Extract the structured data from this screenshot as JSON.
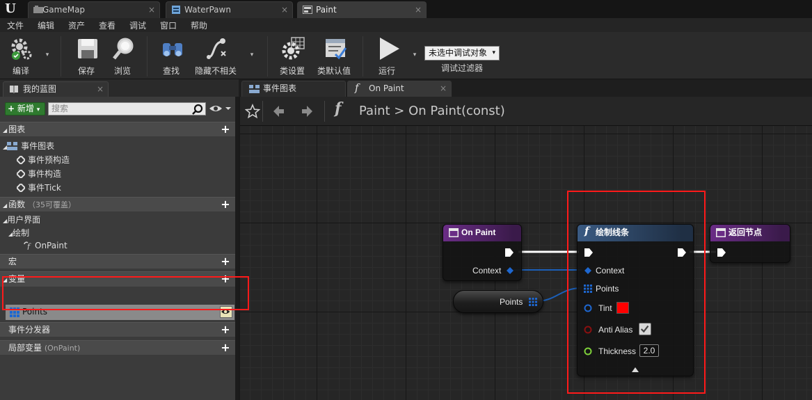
{
  "app": {
    "logo": "U",
    "tabs": [
      {
        "label": "GameMap",
        "icon": "level-map-icon",
        "active": false
      },
      {
        "label": "WaterPawn",
        "icon": "blueprint-icon",
        "active": false
      },
      {
        "label": "Paint",
        "icon": "widget-blueprint-icon",
        "active": true
      }
    ],
    "close_glyph": "×"
  },
  "menu": [
    "文件",
    "编辑",
    "资产",
    "查看",
    "调试",
    "窗口",
    "帮助"
  ],
  "toolbar": {
    "compile": "编译",
    "save": "保存",
    "browse": "浏览",
    "find": "查找",
    "hide_unrelated": "隐藏不相关",
    "class_settings": "类设置",
    "class_defaults": "类默认值",
    "run": "运行",
    "debug_selector": "未选中调试对象",
    "debug_filter": "调试过滤器",
    "caret": "▾"
  },
  "my_blueprint": {
    "tab_label": "我的蓝图",
    "new_button": "新增",
    "search_placeholder": "搜索",
    "sections": {
      "graphs": "图表",
      "functions": "函数",
      "functions_sub": "（35可覆盖）",
      "ui": "用户界面",
      "macros": "宏",
      "variables": "变量",
      "event_dispatchers": "事件分发器",
      "local_vars": "局部变量",
      "local_vars_sub": "(OnPaint)"
    },
    "graph_items": {
      "event_graph": "事件图表",
      "events": [
        "事件预构造",
        "事件构造",
        "事件Tick"
      ]
    },
    "ui_items": {
      "draw": "绘制",
      "on_paint": "OnPaint"
    },
    "variables": [
      {
        "name": "Points",
        "type": "array"
      }
    ]
  },
  "graph_editor": {
    "tabs": [
      {
        "label": "事件图表",
        "icon": "event-graph-icon",
        "active": false
      },
      {
        "label": "On Paint",
        "icon": "function-icon",
        "active": true
      }
    ],
    "breadcrumb": [
      "Paint",
      "On Paint(const)"
    ],
    "breadcrumb_sep": ">",
    "func_glyph": "f"
  },
  "nodes": {
    "on_paint": {
      "title": "On Paint",
      "pin_context": "Context",
      "color": "#6a2d86"
    },
    "draw_lines": {
      "title": "绘制线条",
      "pins": {
        "context": "Context",
        "points": "Points",
        "tint": "Tint",
        "anti_alias": "Anti Alias",
        "thickness": "Thickness"
      },
      "tint_color": "#ff0000",
      "anti_alias_checked": true,
      "thickness_value": "2.0",
      "color": "#3a5a82"
    },
    "return_node": {
      "title": "返回节点",
      "color": "#6a2d86"
    },
    "points_var": {
      "label": "Points"
    }
  },
  "colors": {
    "exec_wire": "#ffffff",
    "struct_wire": "#1b5fb8",
    "array_pin": "#1e67d0",
    "highlight_box": "#ff1a1a"
  }
}
